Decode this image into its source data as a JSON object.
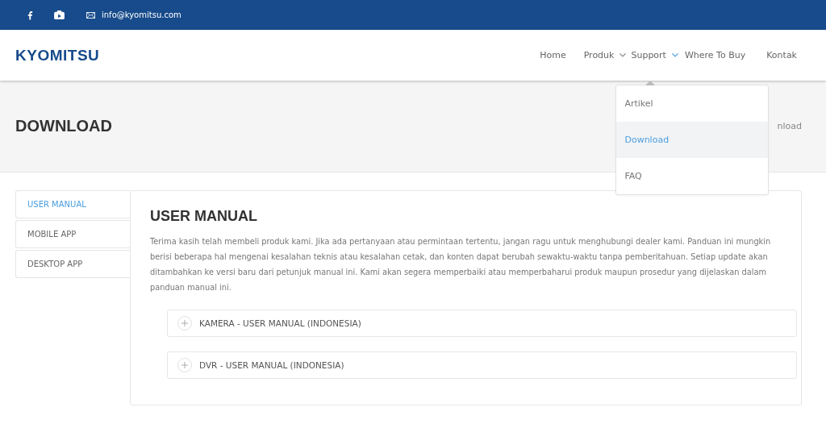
{
  "topbar": {
    "social": [
      {
        "kind": "facebook"
      },
      {
        "kind": "youtube"
      }
    ],
    "email": "info@kyomitsu.com"
  },
  "header": {
    "logo": "KYOMITSU",
    "nav": [
      {
        "label": "Home",
        "kind": "link"
      },
      {
        "label": "Produk",
        "kind": "dropdown",
        "expanded": false
      },
      {
        "label": "Support",
        "kind": "dropdown",
        "expanded": true,
        "menu": [
          {
            "label": "Artikel",
            "selected": false
          },
          {
            "label": "Download",
            "selected": true
          },
          {
            "label": "FAQ",
            "selected": false
          }
        ]
      },
      {
        "label": "Where To Buy",
        "kind": "link"
      },
      {
        "label": "Kontak",
        "kind": "link"
      }
    ]
  },
  "banner": {
    "title": "DOWNLOAD",
    "breadcrumb": "nload"
  },
  "sidebar": {
    "tabs": [
      {
        "label": "USER MANUAL",
        "selected": true
      },
      {
        "label": "MOBILE APP",
        "selected": false
      },
      {
        "label": "DESKTOP APP",
        "selected": false
      }
    ]
  },
  "content": {
    "title": "USER MANUAL",
    "text": "Terima kasih telah membeli produk kami. Jika ada pertanyaan atau permintaan tertentu, jangan ragu untuk menghubungi dealer kami. Panduan ini mungkin berisi beberapa hal mengenai kesalahan teknis atau kesalahan cetak, dan konten dapat berubah sewaktu-waktu tanpa pemberitahuan. Setiap update akan ditambahkan ke versi baru dari petunjuk manual ini. Kami akan segera memperbaiki atau memperbaharui produk maupun prosedur yang dijelaskan dalam panduan manual ini.",
    "accordion": [
      {
        "label": "KAMERA - USER MANUAL (INDONESIA)",
        "expanded": false
      },
      {
        "label": "DVR - USER MANUAL (INDONESIA)",
        "expanded": false
      }
    ]
  }
}
